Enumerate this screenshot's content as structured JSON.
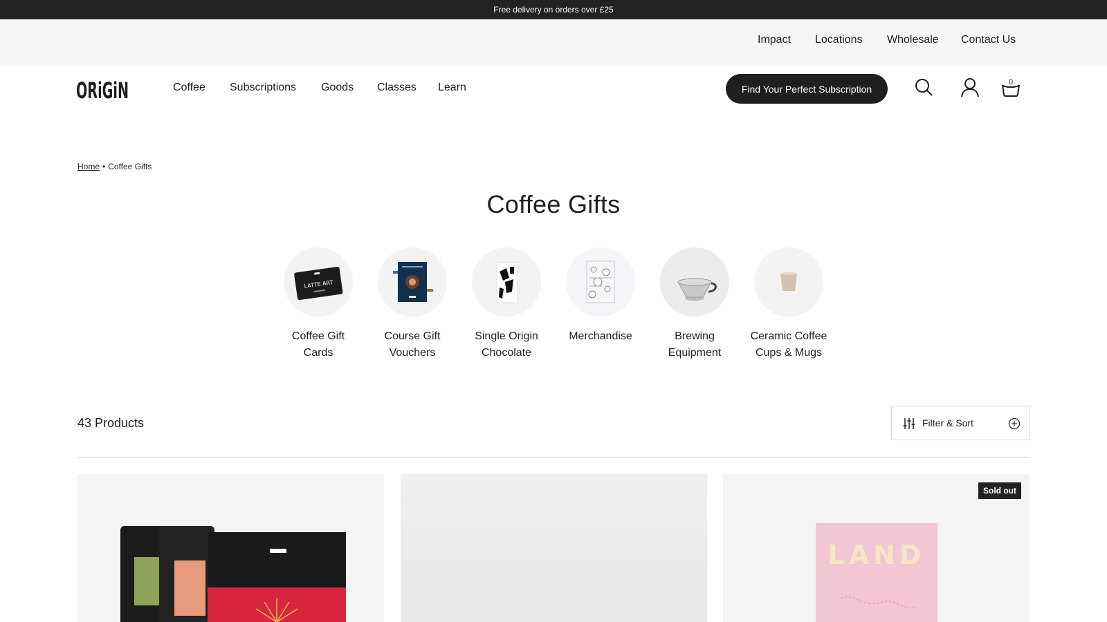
{
  "announcement": {
    "text": "Free delivery on orders over £25"
  },
  "utility_nav": {
    "items": [
      "Impact",
      "Locations",
      "Wholesale",
      "Contact Us"
    ]
  },
  "brand": {
    "logo_text": "ORiGiN"
  },
  "main_nav": {
    "items": [
      "Coffee",
      "Subscriptions",
      "Goods",
      "Classes",
      "Learn"
    ]
  },
  "cta": {
    "label": "Find Your Perfect Subscription"
  },
  "header_icons": {
    "search": "search-icon",
    "account": "user-icon",
    "cart": "cart-icon",
    "cart_count": "0"
  },
  "breadcrumb": {
    "home": "Home",
    "separator": "•",
    "current": "Coffee Gifts"
  },
  "page": {
    "title": "Coffee Gifts"
  },
  "categories": [
    {
      "label": "Coffee Gift Cards"
    },
    {
      "label": "Course Gift Vouchers"
    },
    {
      "label": "Single Origin Chocolate"
    },
    {
      "label": "Merchandise"
    },
    {
      "label": "Brewing Equipment"
    },
    {
      "label": "Ceramic Coffee Cups & Mugs"
    }
  ],
  "gift_card_image": {
    "text": "LATTE ART"
  },
  "products": {
    "count_label": "43 Products"
  },
  "filter": {
    "label": "Filter & Sort"
  },
  "cards": [
    {
      "badge": ""
    },
    {
      "badge": ""
    },
    {
      "badge": "Sold out",
      "image_text": "LAND"
    }
  ],
  "colors": {
    "dark": "#222222",
    "light_bg": "#f5f5f5",
    "accent_red": "#d7263d",
    "pink": "#f2c6d2"
  }
}
